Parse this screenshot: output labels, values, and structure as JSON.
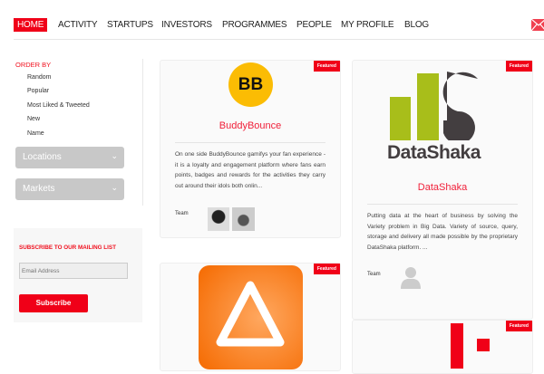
{
  "nav": {
    "items": [
      "HOME",
      "ACTIVITY",
      "STARTUPS",
      "INVESTORS",
      "PROGRAMMES",
      "PEOPLE",
      "MY PROFILE",
      "BLOG"
    ]
  },
  "sidebar": {
    "order_by": "ORDER BY",
    "order_items": [
      "Random",
      "Popular",
      "Most Liked & Tweeted",
      "New",
      "Name"
    ],
    "locations": "Locations",
    "markets": "Markets",
    "subscribe_heading": "SUBSCRIBE TO OUR MAILING LIST",
    "email_placeholder": "Email Address",
    "subscribe_button": "Subscribe"
  },
  "cards": [
    {
      "badge": "Featured",
      "logo_text": "BB",
      "title": "BuddyBounce",
      "text": "On one side BuddyBounce gamifys your fan experience - it is a loyalty and engagement platform where fans earn points, badges and rewards for the activities they carry out around their idols both onlin...",
      "team_label": "Team"
    },
    {
      "badge": "Featured",
      "logo_text": "DataShaka",
      "title": "DataShaka",
      "text": "Putting data at the heart of business by solving the Variety problem in Big Data. Variety of source, query, storage and delivery all made possible by the proprietary DataShaka platform. ...",
      "team_label": "Team"
    },
    {
      "badge": "Featured"
    },
    {
      "badge": "Featured"
    }
  ],
  "colors": {
    "accent": "#f00018"
  }
}
